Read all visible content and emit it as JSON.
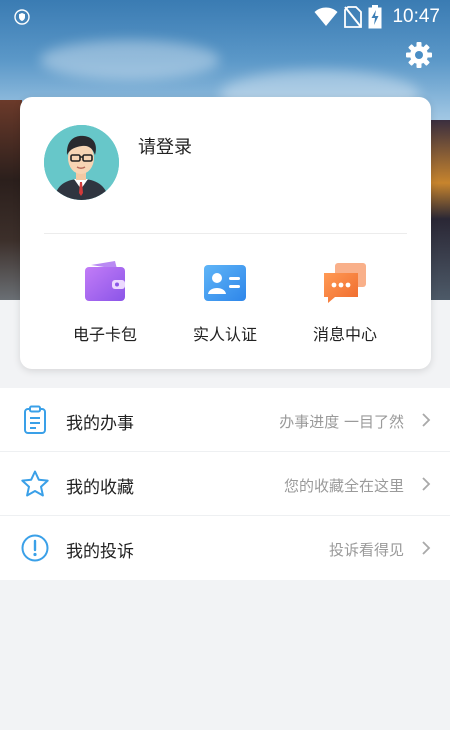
{
  "status_bar": {
    "time": "10:47",
    "icons": [
      "shield-icon",
      "wifi-icon",
      "no-sim-icon",
      "battery-charging-icon"
    ]
  },
  "header": {
    "settings_icon": "gear-icon"
  },
  "profile": {
    "avatar_icon": "user-avatar-icon",
    "login_label": "请登录"
  },
  "shortcuts": [
    {
      "label": "电子卡包",
      "icon": "wallet-icon",
      "color": "#a66cf2"
    },
    {
      "label": "实人认证",
      "icon": "id-card-icon",
      "color": "#3f9bf0"
    },
    {
      "label": "消息中心",
      "icon": "message-icon",
      "color": "#f57d3c"
    }
  ],
  "menu": [
    {
      "label": "我的办事",
      "hint": "办事进度 一目了然",
      "icon": "clipboard-icon"
    },
    {
      "label": "我的收藏",
      "hint": "您的收藏全在这里",
      "icon": "star-icon"
    },
    {
      "label": "我的投诉",
      "hint": "投诉看得见",
      "icon": "alert-circle-icon"
    }
  ],
  "colors": {
    "accent_blue": "#3aa0e8",
    "background": "#f2f3f5",
    "hint_gray": "#9a9a9a"
  }
}
